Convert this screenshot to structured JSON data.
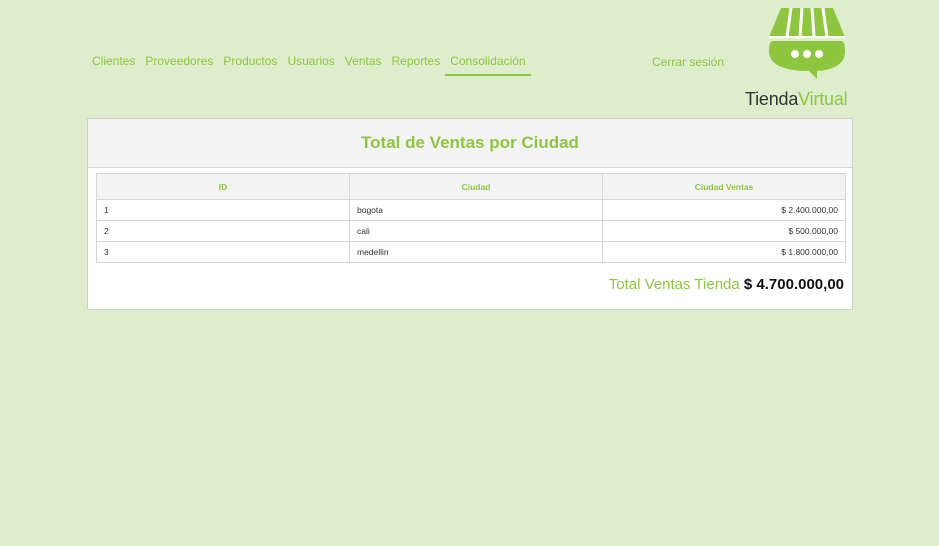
{
  "nav": {
    "items": [
      {
        "label": "Clientes"
      },
      {
        "label": "Proveedores"
      },
      {
        "label": "Productos"
      },
      {
        "label": "Usuarios"
      },
      {
        "label": "Ventas"
      },
      {
        "label": "Reportes"
      },
      {
        "label": "Consolidación"
      }
    ],
    "active": "Consolidación",
    "logout": "Cerrar sesión"
  },
  "logo": {
    "part1": "Tienda",
    "part2": "Virtual"
  },
  "panel": {
    "title": "Total de Ventas por Ciudad"
  },
  "table": {
    "headers": [
      "ID",
      "Ciudad",
      "Ciudad Ventas"
    ],
    "rows": [
      [
        "1",
        "bogota",
        "$ 2.400.000,00"
      ],
      [
        "2",
        "cali",
        "$ 500.000,00"
      ],
      [
        "3",
        "medellin",
        "$ 1.800.000,00"
      ]
    ]
  },
  "total": {
    "label": "Total Ventas Tienda",
    "value": "$ 4.700.000,00"
  },
  "colors": {
    "accent": "#8ec63f",
    "background": "#deedcb",
    "text": "#333333"
  }
}
